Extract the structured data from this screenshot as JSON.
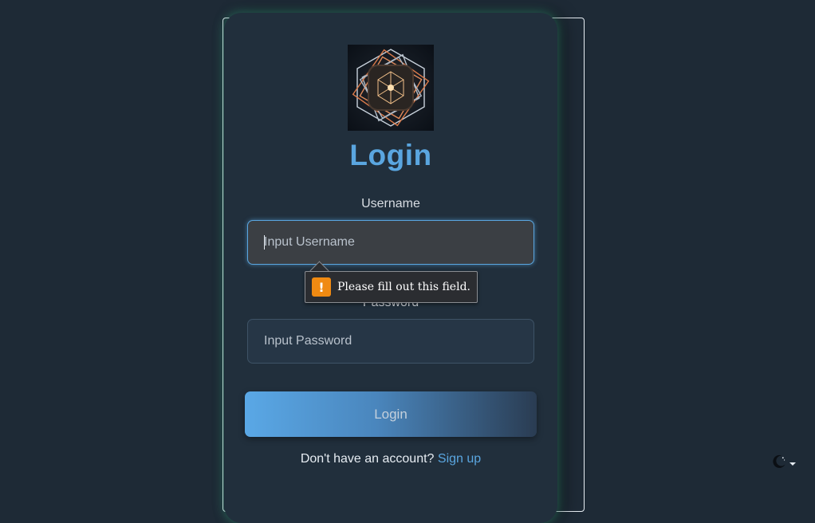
{
  "login": {
    "title": "Login",
    "username_label": "Username",
    "username_placeholder": "Input Username",
    "password_label": "Password",
    "password_placeholder": "Input Password",
    "submit_label": "Login",
    "signup_prompt": "Don't have an account?",
    "signup_link": "Sign up"
  },
  "validation": {
    "icon": "warning-icon",
    "glyph": "!",
    "message": "Please fill out this field."
  },
  "theme_toggle": {
    "icon": "moon-icon"
  },
  "colors": {
    "accent": "#5aa6e0",
    "background": "#1e2a36",
    "card": "#212f3c",
    "warning": "#f08a12"
  }
}
